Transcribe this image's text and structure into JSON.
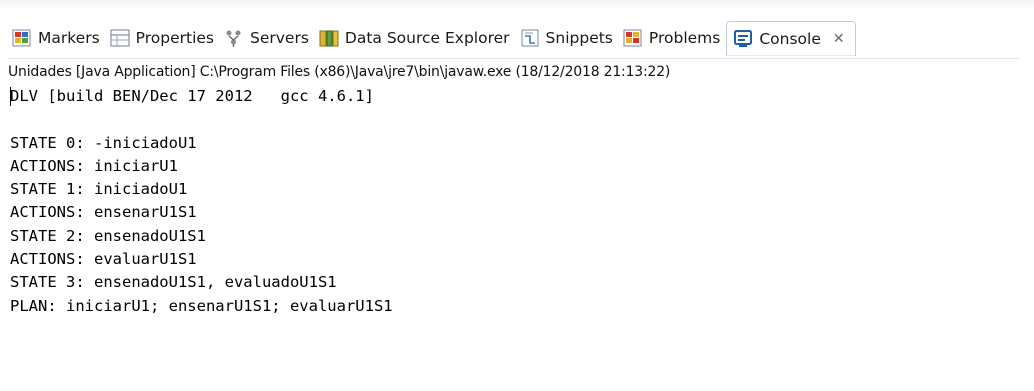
{
  "tabs": [
    {
      "label": "Markers",
      "icon": "markers-icon",
      "active": false
    },
    {
      "label": "Properties",
      "icon": "properties-icon",
      "active": false
    },
    {
      "label": "Servers",
      "icon": "servers-icon",
      "active": false
    },
    {
      "label": "Data Source Explorer",
      "icon": "data-source-explorer-icon",
      "active": false
    },
    {
      "label": "Snippets",
      "icon": "snippets-icon",
      "active": false
    },
    {
      "label": "Problems",
      "icon": "problems-icon",
      "active": false
    },
    {
      "label": "Console",
      "icon": "console-icon",
      "active": true
    }
  ],
  "close_glyph": "✕",
  "launch_info": "Unidades [Java Application] C:\\Program Files (x86)\\Java\\jre7\\bin\\javaw.exe (18/12/2018 21:13:22)",
  "console_lines": [
    "DLV [build BEN/Dec 17 2012   gcc 4.6.1]",
    "",
    "STATE 0: -iniciadoU1",
    "ACTIONS: iniciarU1",
    "STATE 1: iniciadoU1",
    "ACTIONS: ensenarU1S1",
    "STATE 2: ensenadoU1S1",
    "ACTIONS: evaluarU1S1",
    "STATE 3: ensenadoU1S1, evaluadoU1S1",
    "PLAN: iniciarU1; ensenarU1S1; evaluarU1S1"
  ],
  "colors": {
    "active_tab_border": "#b9cde6",
    "console_text": "#000000",
    "icon_blue": "#1f5fa8"
  }
}
